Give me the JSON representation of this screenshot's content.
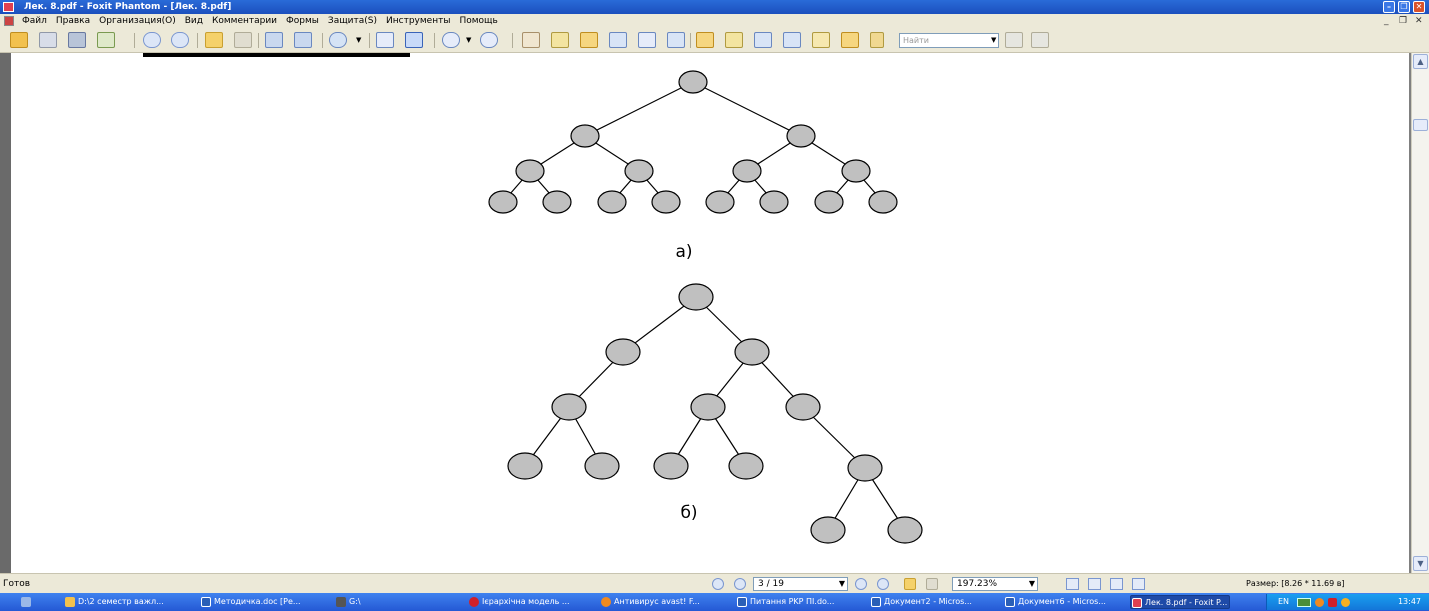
{
  "window": {
    "title": "Лек. 8.pdf - Foxit Phantom - [Лек. 8.pdf]"
  },
  "menu": {
    "items": [
      "Файл",
      "Правка",
      "Организация(O)",
      "Вид",
      "Комментарии",
      "Формы",
      "Защита(S)",
      "Инструменты",
      "Помощь"
    ]
  },
  "toolbar": {
    "find_placeholder": "Найти"
  },
  "document": {
    "caption_a": "а)",
    "caption_b": "б)"
  },
  "statusbar": {
    "status": "Готов",
    "page": "3 / 19",
    "zoom": "197.23%",
    "size": "Размер: [8.26 * 11.69 в]"
  },
  "taskbar": {
    "items": [
      "D:\\2 семестр важл...",
      "Методичка.doc [Ре...",
      "G:\\",
      "Ієрархічна модель ...",
      "Антивирус avast! F...",
      "Питання PKP ПІ.do...",
      "Документ2 - Micros...",
      "Документ6 - Micros...",
      "Лек. 8.pdf - Foxit P..."
    ],
    "lang": "EN",
    "clock": "13:47"
  },
  "colors": {
    "node_fill": "#c0c0c0",
    "titlebar": "#2a6bd8",
    "taskbar": "#2458d4"
  }
}
